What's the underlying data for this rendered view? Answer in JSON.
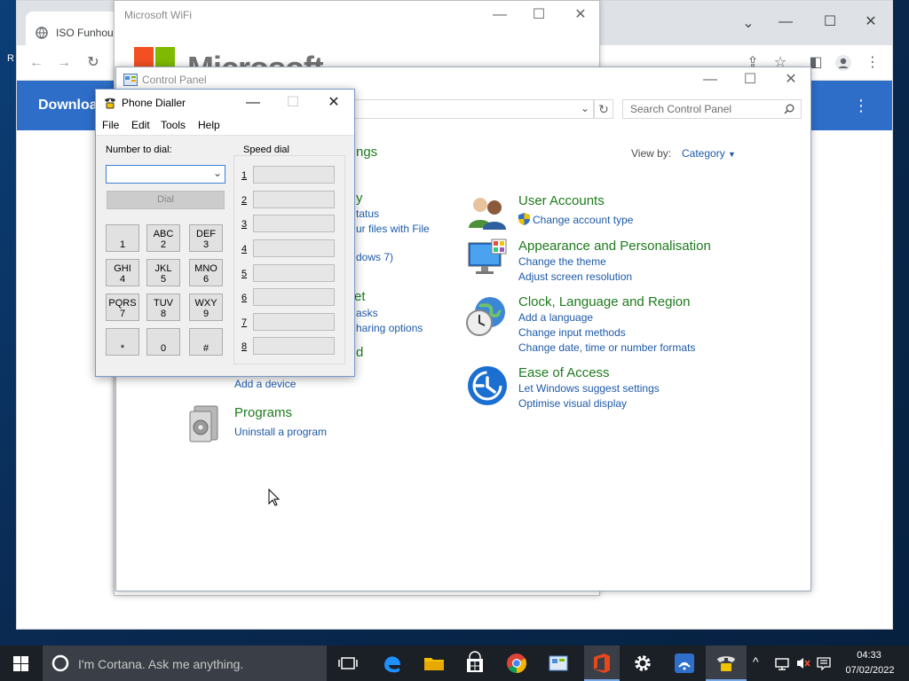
{
  "desktop": {
    "edge_char": "R"
  },
  "browser": {
    "tab_title": "ISO Funhous",
    "banner_text": "Downloa"
  },
  "wifi_window": {
    "title": "Microsoft WiFi",
    "brand_text": "Microsoft"
  },
  "control_panel": {
    "title": "Control Panel",
    "search_placeholder": "Search Control Panel",
    "view_by_label": "View by:",
    "view_by_value": "Category",
    "partial_left": {
      "heading1": "ngs",
      "line1": "y",
      "line2": "tatus",
      "line3": "ur files with File",
      "line4": "dows 7)",
      "heading2": "et",
      "line5": "asks",
      "line6": "haring options",
      "heading3": "d"
    },
    "hardware": {
      "add_device": "Add a device"
    },
    "programs": {
      "title": "Programs",
      "link1": "Uninstall a program"
    },
    "user_accounts": {
      "title": "User Accounts",
      "link1": "Change account type"
    },
    "appearance": {
      "title": "Appearance and Personalisation",
      "link1": "Change the theme",
      "link2": "Adjust screen resolution"
    },
    "clock": {
      "title": "Clock, Language and Region",
      "link1": "Add a language",
      "link2": "Change input methods",
      "link3": "Change date, time or number formats"
    },
    "ease": {
      "title": "Ease of Access",
      "link1": "Let Windows suggest settings",
      "link2": "Optimise visual display"
    }
  },
  "phone_dialler": {
    "title": "Phone Dialler",
    "menu": [
      "File",
      "Edit",
      "Tools",
      "Help"
    ],
    "number_label": "Number to dial:",
    "dial_button": "Dial",
    "speed_label": "Speed dial",
    "keys": [
      {
        "top": "",
        "bottom": "1"
      },
      {
        "top": "ABC",
        "bottom": "2"
      },
      {
        "top": "DEF",
        "bottom": "3"
      },
      {
        "top": "GHI",
        "bottom": "4"
      },
      {
        "top": "JKL",
        "bottom": "5"
      },
      {
        "top": "MNO",
        "bottom": "6"
      },
      {
        "top": "PQRS",
        "bottom": "7"
      },
      {
        "top": "TUV",
        "bottom": "8"
      },
      {
        "top": "WXY",
        "bottom": "9"
      },
      {
        "top": "",
        "bottom": "*"
      },
      {
        "top": "",
        "bottom": "0"
      },
      {
        "top": "",
        "bottom": "#"
      }
    ],
    "speed_numbers": [
      "1",
      "2",
      "3",
      "4",
      "5",
      "6",
      "7",
      "8"
    ]
  },
  "taskbar": {
    "cortana_text": "I'm Cortana. Ask me anything.",
    "time": "04:33",
    "date": "07/02/2022"
  },
  "colors": {
    "link_blue": "#1e5aa8",
    "category_green": "#1e7b1e",
    "browser_blue": "#2e6ec9",
    "taskbar": "#1b1f26"
  }
}
